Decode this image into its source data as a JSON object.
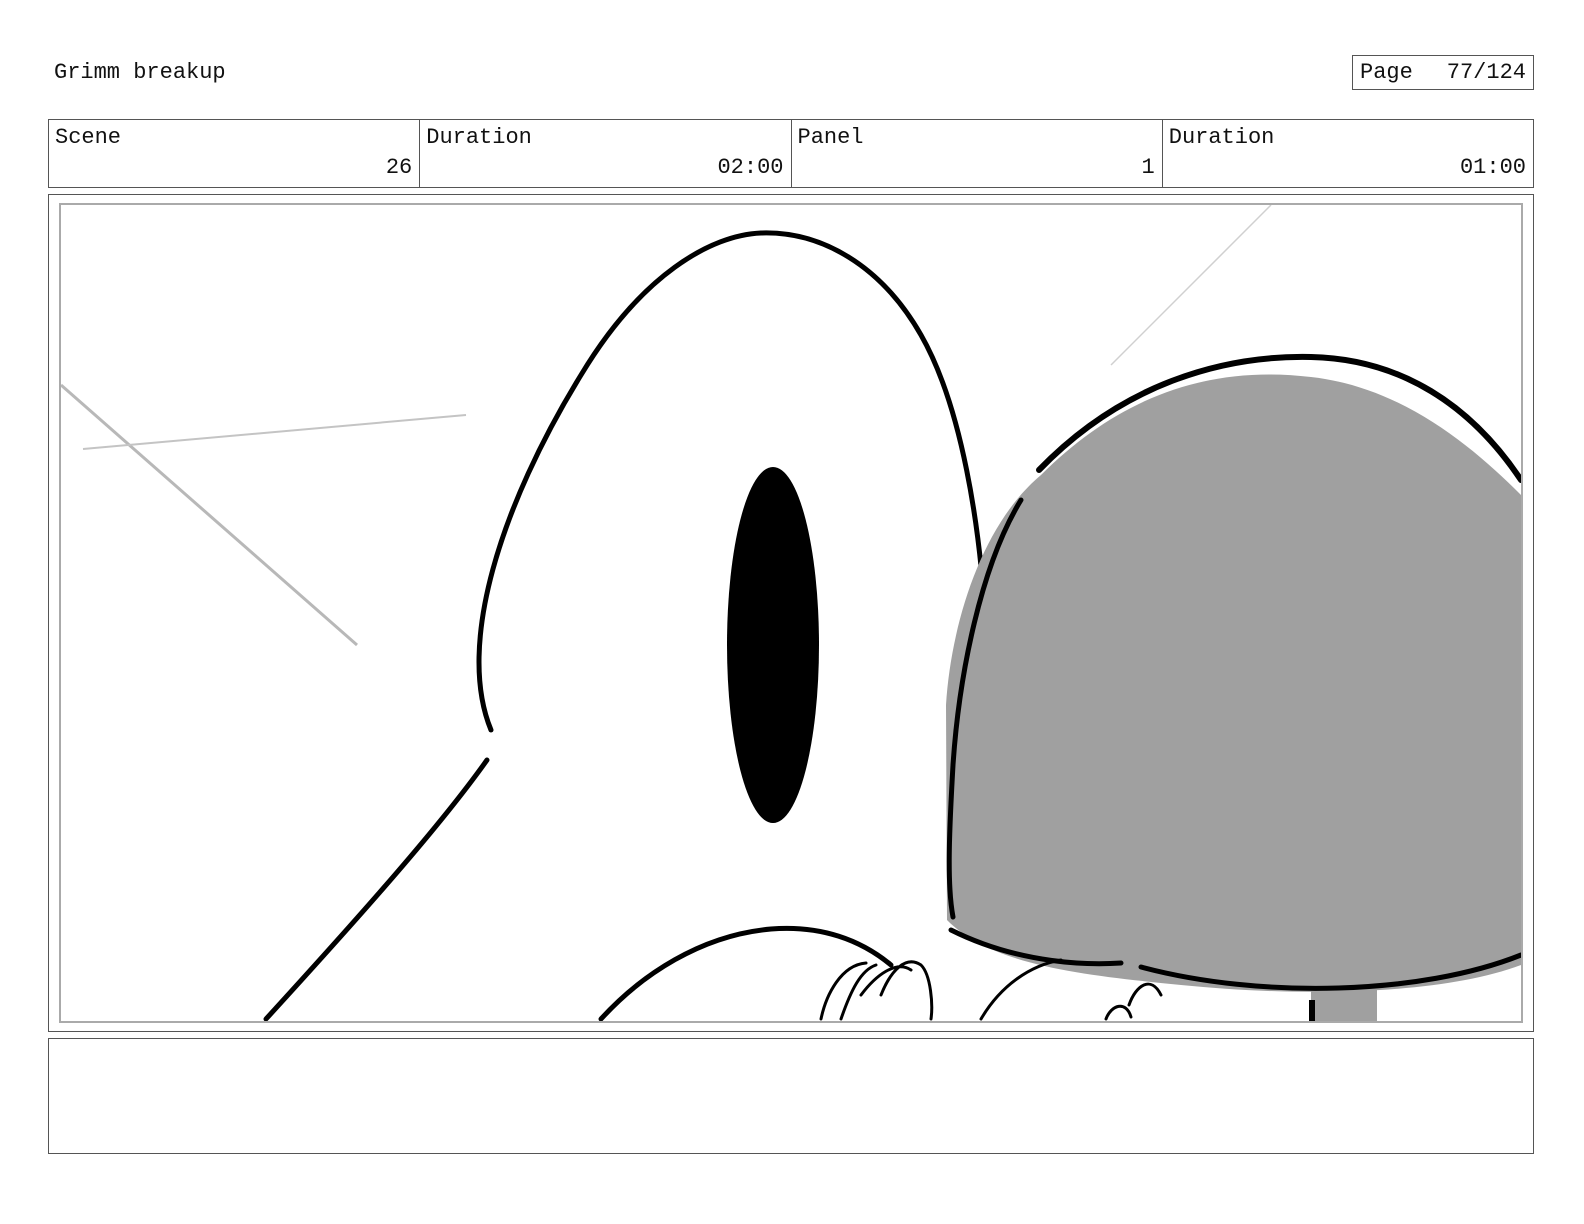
{
  "header": {
    "title": "Grimm breakup",
    "page_label": "Page",
    "page_value": "77/124"
  },
  "info": {
    "scene_label": "Scene",
    "scene_value": "26",
    "scene_duration_label": "Duration",
    "scene_duration_value": "02:00",
    "panel_label": "Panel",
    "panel_value": "1",
    "panel_duration_label": "Duration",
    "panel_duration_value": "01:00"
  },
  "artwork": {
    "description_icon": "storyboard-sketch-icon",
    "colors": {
      "ink": "#000000",
      "fill_gray": "#a0a0a0",
      "guide_gray": "#b8b8b8"
    }
  },
  "notes": {
    "text": ""
  }
}
